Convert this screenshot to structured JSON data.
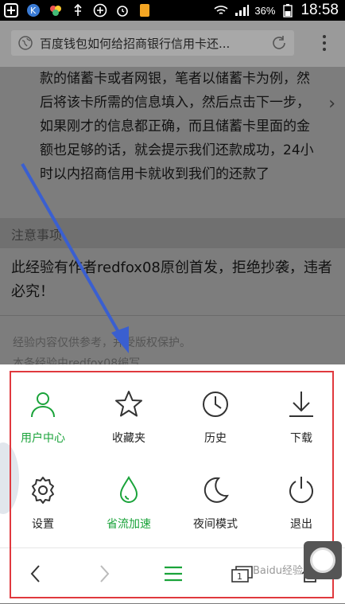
{
  "status_bar": {
    "icons": [
      "add-icon",
      "k-app-icon",
      "color-icon",
      "usb-icon",
      "plus-circle-icon",
      "alarm-icon",
      "sim-icon",
      "wifi-icon",
      "signal-icon",
      "battery-icon"
    ],
    "battery": "36%",
    "time": "18:58"
  },
  "address_bar": {
    "title": "百度钱包如何给招商银行信用卡还..."
  },
  "content": {
    "paragraph": "款的储蓄卡或者网银，笔者以储蓄卡为例，然后将该卡所需的信息填入，然后点击下一步，如果刚才的信息都正确，而且储蓄卡里面的金额也足够的话，就会提示我们还款成功，24小时以内招商信用卡就收到我们的还款了",
    "notice_heading": "注意事项",
    "warning": "此经验有作者redfox08原创首发，拒绝抄袭，违者必究！",
    "footer1": "经验内容仅供参考，并受版权保护。",
    "footer2": "本条经验由redfox08编写"
  },
  "menu": {
    "items": [
      {
        "label": "用户中心",
        "icon": "user-icon",
        "active": true
      },
      {
        "label": "收藏夹",
        "icon": "star-icon",
        "active": false
      },
      {
        "label": "历史",
        "icon": "clock-icon",
        "active": false
      },
      {
        "label": "下载",
        "icon": "download-icon",
        "active": false
      },
      {
        "label": "设置",
        "icon": "gear-icon",
        "active": false
      },
      {
        "label": "省流加速",
        "icon": "drop-icon",
        "active": true
      },
      {
        "label": "夜间模式",
        "icon": "moon-icon",
        "active": false
      },
      {
        "label": "退出",
        "icon": "power-icon",
        "active": false
      }
    ]
  },
  "bottom_bar": {
    "tab_count": "1",
    "icons": [
      "back-icon",
      "forward-icon",
      "menu-icon",
      "tabs-icon",
      "home-icon"
    ]
  },
  "colors": {
    "accent_green": "#1aa33a",
    "highlight_red": "#e0393e",
    "arrow_blue": "#3a5fd0"
  },
  "watermark": "Baidu经验"
}
